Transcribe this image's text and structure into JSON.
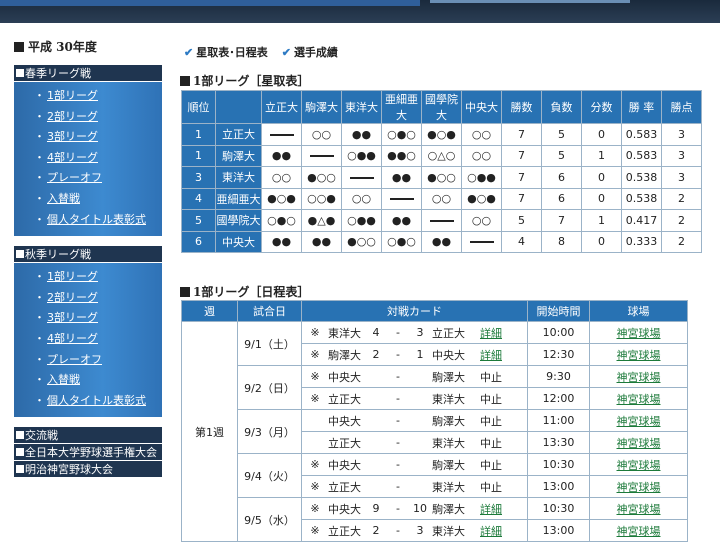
{
  "sidebar": {
    "season_title": "平成 30年度",
    "sections": [
      {
        "title": "春季リーグ戦",
        "links": [
          "1部リーグ",
          "2部リーグ",
          "3部リーグ",
          "4部リーグ",
          "プレーオフ",
          "入替戦",
          "個人タイトル表彰式"
        ]
      },
      {
        "title": "秋季リーグ戦",
        "links": [
          "1部リーグ",
          "2部リーグ",
          "3部リーグ",
          "4部リーグ",
          "プレーオフ",
          "入替戦",
          "個人タイトル表彰式"
        ]
      },
      {
        "title": "交流戦",
        "links": []
      },
      {
        "title": "全日本大学野球選手権大会",
        "links": []
      },
      {
        "title": "明治神宮野球大会",
        "links": []
      }
    ]
  },
  "tabs": [
    "星取表･日程表",
    "選手成績"
  ],
  "standings": {
    "title": "1部リーグ［星取表］",
    "headers": [
      "順位",
      "",
      "立正大",
      "駒澤大",
      "東洋大",
      "亜細亜大",
      "國學院大",
      "中央大",
      "勝数",
      "負数",
      "分数",
      "勝 率",
      "勝点"
    ],
    "rows": [
      {
        "rank": "1",
        "team": "立正大",
        "cells": [
          "—",
          "○○",
          "●●",
          "○●○",
          "●○●",
          "○○"
        ],
        "w": "7",
        "l": "5",
        "d": "0",
        "pct": "0.583",
        "pts": "3"
      },
      {
        "rank": "1",
        "team": "駒澤大",
        "cells": [
          "●●",
          "—",
          "○●●",
          "●●○",
          "○△○",
          "○○"
        ],
        "w": "7",
        "l": "5",
        "d": "1",
        "pct": "0.583",
        "pts": "3"
      },
      {
        "rank": "3",
        "team": "東洋大",
        "cells": [
          "○○",
          "●○○",
          "—",
          "●●",
          "●○○",
          "○●●"
        ],
        "w": "7",
        "l": "6",
        "d": "0",
        "pct": "0.538",
        "pts": "3"
      },
      {
        "rank": "4",
        "team": "亜細亜大",
        "cells": [
          "●○●",
          "○○●",
          "○○",
          "—",
          "○○",
          "●○●"
        ],
        "w": "7",
        "l": "6",
        "d": "0",
        "pct": "0.538",
        "pts": "2"
      },
      {
        "rank": "5",
        "team": "國學院大",
        "cells": [
          "○●○",
          "●△●",
          "○●●",
          "●●",
          "—",
          "○○"
        ],
        "w": "5",
        "l": "7",
        "d": "1",
        "pct": "0.417",
        "pts": "2"
      },
      {
        "rank": "6",
        "team": "中央大",
        "cells": [
          "●●",
          "●●",
          "●○○",
          "○●○",
          "●●",
          "—"
        ],
        "w": "4",
        "l": "8",
        "d": "0",
        "pct": "0.333",
        "pts": "2"
      }
    ]
  },
  "schedule": {
    "title": "1部リーグ［日程表］",
    "headers": [
      "週",
      "試合日",
      "対戦カード",
      "開始時間",
      "球場"
    ],
    "week": "第1週",
    "days": [
      {
        "date": "9/1（土）",
        "games": [
          {
            "mark": "※",
            "t1": "東洋大",
            "s1": "4",
            "dash": "-",
            "s2": "3",
            "t2": "立正大",
            "note": "詳細",
            "time": "10:00",
            "venue": "神宮球場"
          },
          {
            "mark": "※",
            "t1": "駒澤大",
            "s1": "2",
            "dash": "-",
            "s2": "1",
            "t2": "中央大",
            "note": "詳細",
            "time": "12:30",
            "venue": "神宮球場"
          }
        ]
      },
      {
        "date": "9/2（日）",
        "games": [
          {
            "mark": "※",
            "t1": "中央大",
            "s1": "",
            "dash": "-",
            "s2": "",
            "t2": "駒澤大",
            "note": "中止",
            "time": "9:30",
            "venue": "神宮球場"
          },
          {
            "mark": "※",
            "t1": "立正大",
            "s1": "",
            "dash": "-",
            "s2": "",
            "t2": "東洋大",
            "note": "中止",
            "time": "12:00",
            "venue": "神宮球場"
          }
        ]
      },
      {
        "date": "9/3（月）",
        "games": [
          {
            "mark": "",
            "t1": "中央大",
            "s1": "",
            "dash": "-",
            "s2": "",
            "t2": "駒澤大",
            "note": "中止",
            "time": "11:00",
            "venue": "神宮球場"
          },
          {
            "mark": "",
            "t1": "立正大",
            "s1": "",
            "dash": "-",
            "s2": "",
            "t2": "東洋大",
            "note": "中止",
            "time": "13:30",
            "venue": "神宮球場"
          }
        ]
      },
      {
        "date": "9/4（火）",
        "games": [
          {
            "mark": "※",
            "t1": "中央大",
            "s1": "",
            "dash": "-",
            "s2": "",
            "t2": "駒澤大",
            "note": "中止",
            "time": "10:30",
            "venue": "神宮球場"
          },
          {
            "mark": "※",
            "t1": "立正大",
            "s1": "",
            "dash": "-",
            "s2": "",
            "t2": "東洋大",
            "note": "中止",
            "time": "13:00",
            "venue": "神宮球場"
          }
        ]
      },
      {
        "date": "9/5（水）",
        "games": [
          {
            "mark": "※",
            "t1": "中央大",
            "s1": "9",
            "dash": "-",
            "s2": "10",
            "t2": "駒澤大",
            "note": "詳細",
            "time": "10:30",
            "venue": "神宮球場"
          },
          {
            "mark": "※",
            "t1": "立正大",
            "s1": "2",
            "dash": "-",
            "s2": "3",
            "t2": "東洋大",
            "note": "詳細",
            "time": "13:00",
            "venue": "神宮球場"
          }
        ]
      }
    ]
  },
  "colors": {
    "header_blue": "#2872b3",
    "sidebar_dark": "#1f3550",
    "link_green": "#1c7a3a"
  }
}
